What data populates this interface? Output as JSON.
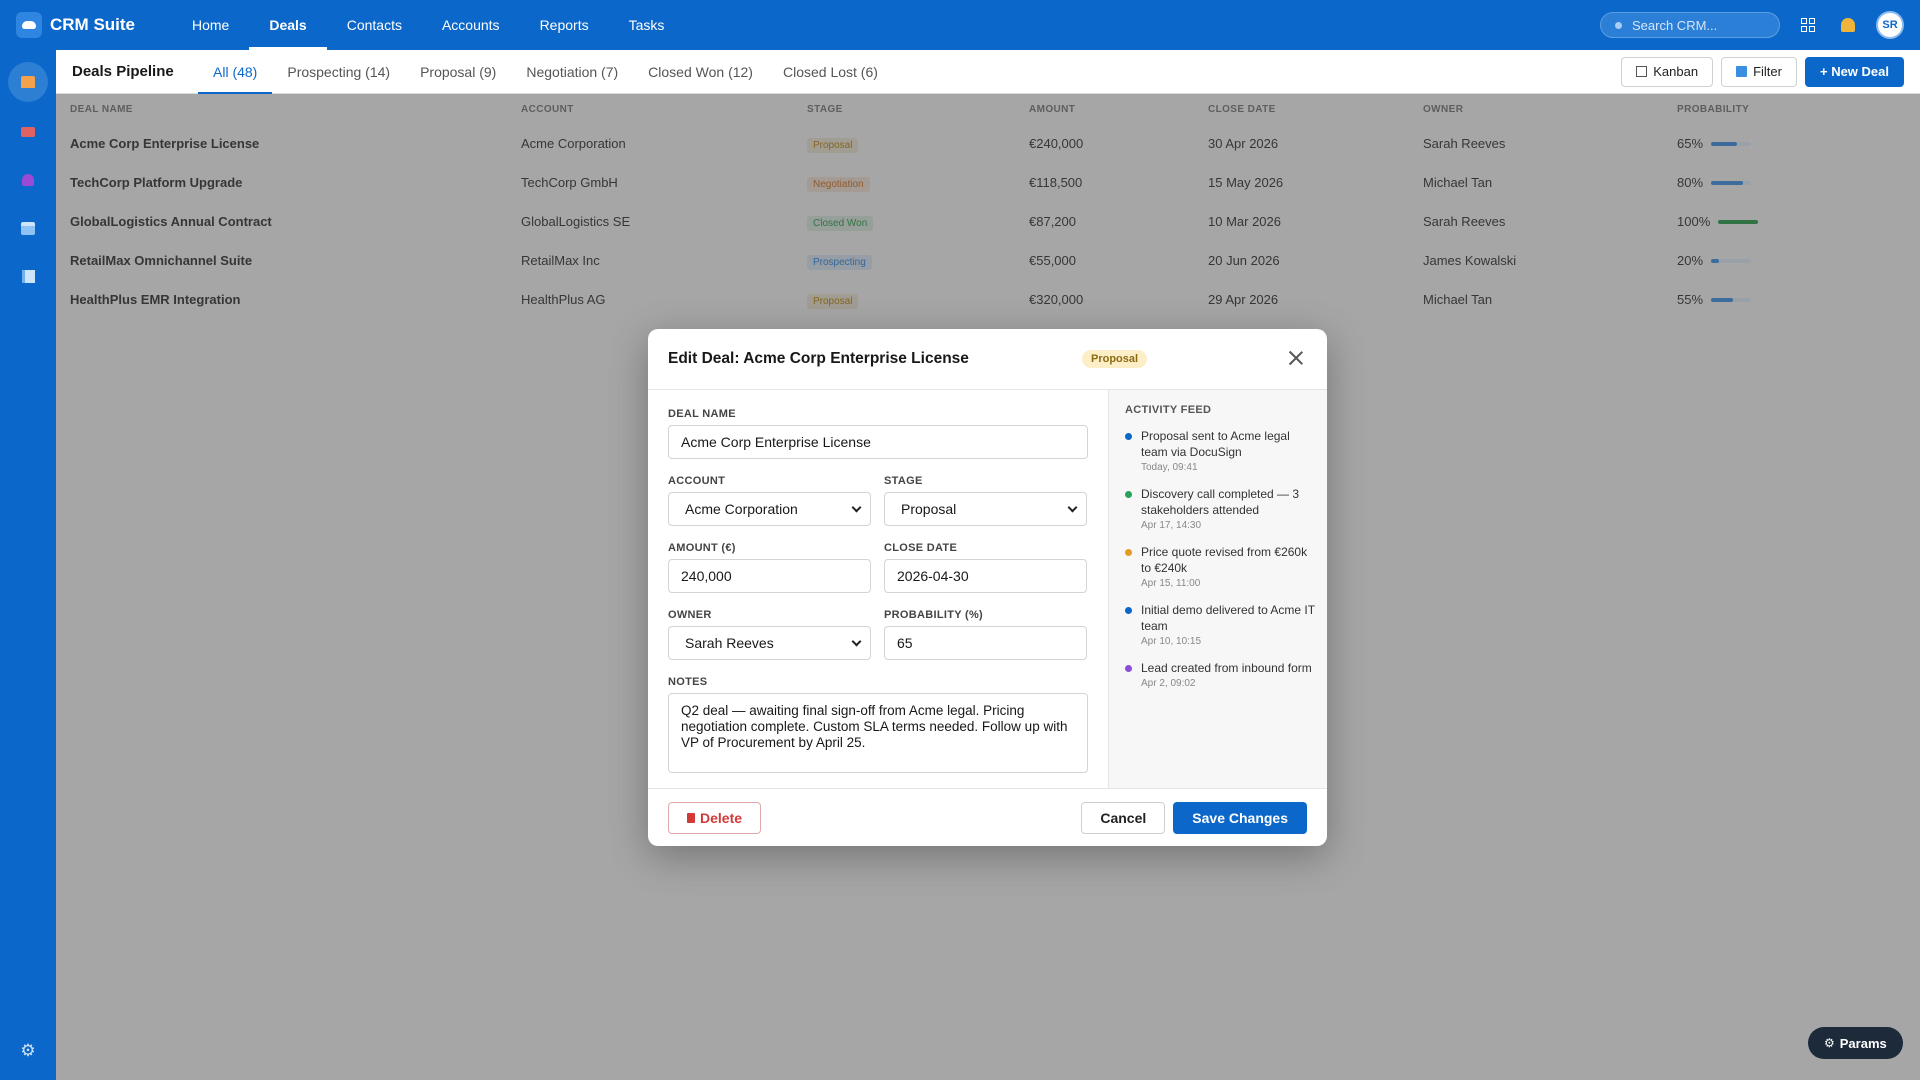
{
  "app": {
    "name": "CRM Suite",
    "nav": [
      "Home",
      "Deals",
      "Contacts",
      "Accounts",
      "Reports",
      "Tasks"
    ],
    "active_nav": "Deals",
    "search_placeholder": "Search CRM...",
    "user_initials": "SR"
  },
  "rail": {
    "icons": [
      "home-icon",
      "mail-icon",
      "people-icon",
      "calendar-icon",
      "chart-icon",
      "gear-icon"
    ],
    "active": "home-icon"
  },
  "subbar": {
    "title": "Deals Pipeline",
    "tabs": [
      "All (48)",
      "Prospecting (14)",
      "Proposal (9)",
      "Negotiation (7)",
      "Closed Won (12)",
      "Closed Lost (6)"
    ],
    "active_tab": "All (48)",
    "kanban_label": "Kanban",
    "filter_label": "Filter",
    "new_deal_label": "+ New Deal"
  },
  "table": {
    "headers": [
      "Deal Name",
      "Account",
      "Stage",
      "Amount",
      "Close Date",
      "Owner",
      "Probability"
    ],
    "rows": [
      {
        "name": "Acme Corp Enterprise License",
        "account": "Acme Corporation",
        "stage": "Proposal",
        "amount": "€240,000",
        "close": "30 Apr 2026",
        "owner": "Sarah Reeves",
        "prob": "65%",
        "prob_value": 0.65
      },
      {
        "name": "TechCorp Platform Upgrade",
        "account": "TechCorp GmbH",
        "stage": "Negotiation",
        "amount": "€118,500",
        "close": "15 May 2026",
        "owner": "Michael Tan",
        "prob": "80%",
        "prob_value": 0.8
      },
      {
        "name": "GlobalLogistics Annual Contract",
        "account": "GlobalLogistics SE",
        "stage": "Closed Won",
        "amount": "€87,200",
        "close": "10 Mar 2026",
        "owner": "Sarah Reeves",
        "prob": "100%",
        "prob_value": 1.0
      },
      {
        "name": "RetailMax Omnichannel Suite",
        "account": "RetailMax Inc",
        "stage": "Prospecting",
        "amount": "€55,000",
        "close": "20 Jun 2026",
        "owner": "James Kowalski",
        "prob": "20%",
        "prob_value": 0.2
      },
      {
        "name": "HealthPlus EMR Integration",
        "account": "HealthPlus AG",
        "stage": "Proposal",
        "amount": "€320,000",
        "close": "29 Apr 2026",
        "owner": "Michael Tan",
        "prob": "55%",
        "prob_value": 0.55
      }
    ],
    "stage_colors": {
      "Proposal": "#b8860b",
      "Negotiation": "#d0701a",
      "Closed Won": "#2a9b4a",
      "Prospecting": "#2f86e0"
    }
  },
  "modal": {
    "title": "Edit Deal: Acme Corp Enterprise License",
    "stage_badge": "Proposal",
    "labels": {
      "deal_name": "Deal Name",
      "account": "Account",
      "stage": "Stage",
      "amount": "Amount (€)",
      "close_date": "Close Date",
      "owner": "Owner",
      "probability": "Probability (%)",
      "notes": "Notes"
    },
    "values": {
      "deal_name": "Acme Corp Enterprise License",
      "account": "Acme Corporation",
      "stage": "Proposal",
      "amount": "240,000",
      "close_date": "2026-04-30",
      "owner": "Sarah Reeves",
      "probability": "65",
      "notes": "Q2 deal — awaiting final sign-off from Acme legal. Pricing negotiation complete. Custom SLA terms needed. Follow up with VP of Procurement by April 25."
    },
    "activity_title": "Activity Feed",
    "activity": [
      {
        "text": "Proposal sent to Acme legal team via DocuSign",
        "time": "Today, 09:41",
        "color": "#0b67c9"
      },
      {
        "text": "Discovery call completed — 3 stakeholders attended",
        "time": "Apr 17, 14:30",
        "color": "#2aa15a"
      },
      {
        "text": "Price quote revised from €260k to €240k",
        "time": "Apr 15, 11:00",
        "color": "#e39a22"
      },
      {
        "text": "Initial demo delivered to Acme IT team",
        "time": "Apr 10, 10:15",
        "color": "#0b67c9"
      },
      {
        "text": "Lead created from inbound form",
        "time": "Apr 2, 09:02",
        "color": "#8a4fd6"
      }
    ],
    "delete_label": "Delete",
    "cancel_label": "Cancel",
    "save_label": "Save Changes"
  },
  "params_label": "Params",
  "colors": {
    "brand": "#0b67c9",
    "danger": "#d23a3a"
  }
}
